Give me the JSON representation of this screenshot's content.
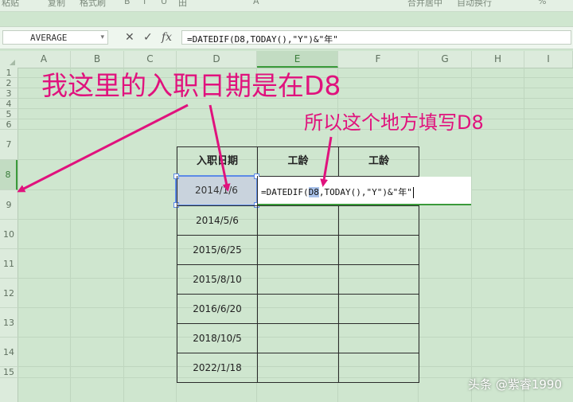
{
  "ribbon": {
    "items": [
      "粘贴",
      "复制",
      "格式刷",
      "B",
      "I",
      "U",
      "田",
      "A",
      "合并居中",
      "自动换行",
      "%"
    ]
  },
  "formula_bar": {
    "name_box": "AVERAGE",
    "cancel_icon": "✕",
    "confirm_icon": "✓",
    "fx_label": "fx",
    "formula": "=DATEDIF(D8,TODAY(),\"Y\")&\"年\""
  },
  "sheet": {
    "columns": [
      "A",
      "B",
      "C",
      "D",
      "E",
      "F",
      "G",
      "H",
      "I"
    ],
    "active_column": "E",
    "rows": [
      "1",
      "2",
      "3",
      "4",
      "5",
      "6",
      "7",
      "8",
      "9",
      "10",
      "11",
      "12",
      "13",
      "14",
      "15"
    ],
    "active_row": "8"
  },
  "table": {
    "headers": [
      "入职日期",
      "工龄",
      "工龄"
    ],
    "dates": [
      "2014/1/6",
      "2014/5/6",
      "2015/6/25",
      "2015/8/10",
      "2016/6/20",
      "2018/10/5",
      "2022/1/18"
    ]
  },
  "editing_cell": {
    "before": "=DATEDIF(",
    "ref": "D8",
    "after": ",TODAY(),\"Y\")&\"年\""
  },
  "annotations": {
    "main": "我这里的入职日期是在D8",
    "secondary": "所以这个地方填写D8",
    "color": "#e0127d"
  },
  "watermark": "头条 @紫睿1990",
  "colors": {
    "sheet_bg": "#cfe6cf",
    "selection_border": "#5c8ae6",
    "active_accent": "#3a9a3a"
  }
}
